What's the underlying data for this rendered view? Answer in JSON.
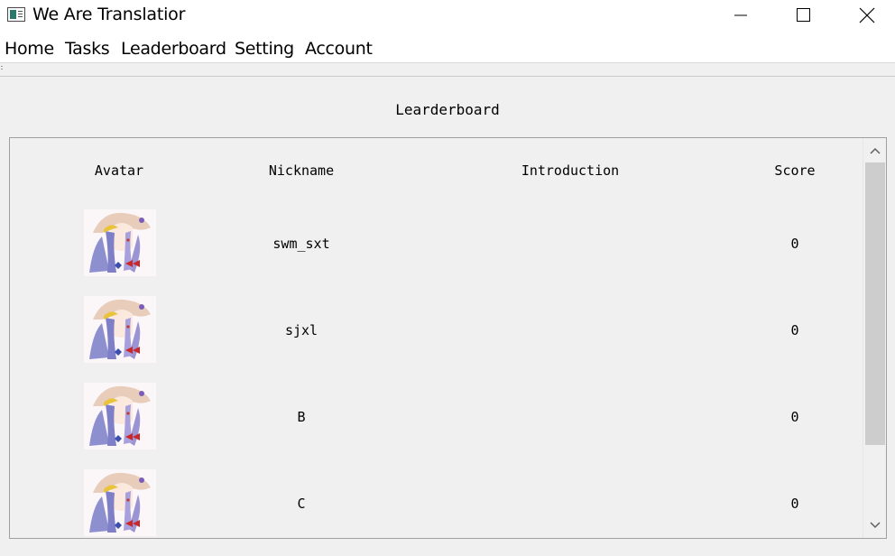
{
  "window": {
    "title": "We Are Translatior",
    "icon": "app-icon",
    "controls": [
      "minimize-icon",
      "maximize-icon",
      "close-icon"
    ]
  },
  "menu": {
    "items": [
      {
        "label": "Home"
      },
      {
        "label": "Tasks"
      },
      {
        "label": "Leaderboard"
      },
      {
        "label": "Setting"
      },
      {
        "label": "Account"
      }
    ]
  },
  "leaderboard": {
    "title": "Learderboard",
    "columns": {
      "avatar": "Avatar",
      "nickname": "Nickname",
      "introduction": "Introduction",
      "score": "Score"
    },
    "rows": [
      {
        "nickname": "swm_sxt",
        "introduction": "",
        "score": "0"
      },
      {
        "nickname": "sjxl",
        "introduction": "",
        "score": "0"
      },
      {
        "nickname": "B",
        "introduction": "",
        "score": "0"
      },
      {
        "nickname": "C",
        "introduction": "",
        "score": "0"
      }
    ]
  },
  "scrollbar": {
    "position": 0
  }
}
